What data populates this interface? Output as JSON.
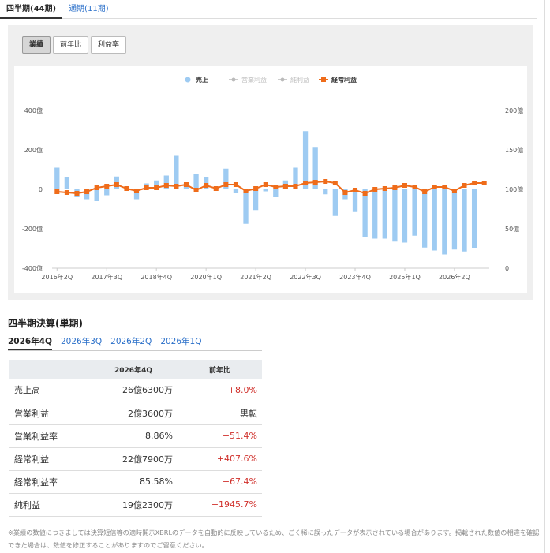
{
  "top_tabs": [
    {
      "label": "四半期(44期)",
      "active": true
    },
    {
      "label": "通期(11期)",
      "active": false
    }
  ],
  "chart_buttons": [
    {
      "label": "業績",
      "active": true
    },
    {
      "label": "前年比",
      "active": false
    },
    {
      "label": "利益率",
      "active": false
    }
  ],
  "colors": {
    "sales_bar": "#9ecbf2",
    "ordinary_profit": "#ef6c1a",
    "operating_profit": "#bbbbbb",
    "net_profit": "#bbbbbb",
    "link": "#2a6fc9",
    "positive": "#d0302b"
  },
  "chart_data": {
    "type": "bar",
    "legend": [
      {
        "name": "売上",
        "marker": "dot",
        "enabled": true
      },
      {
        "name": "営業利益",
        "marker": "line-dot",
        "enabled": false
      },
      {
        "name": "純利益",
        "marker": "line-dot",
        "enabled": false
      },
      {
        "name": "経常利益",
        "marker": "line-square",
        "enabled": true
      }
    ],
    "legend_position": "top-center",
    "left_axis": {
      "ticks": [
        "400億",
        "200億",
        "0",
        "-200億",
        "-400億"
      ],
      "ylim": [
        -400,
        400
      ]
    },
    "right_axis": {
      "ticks": [
        "200億",
        "150億",
        "100億",
        "50億",
        "0"
      ],
      "ylim": [
        0,
        200
      ]
    },
    "x_tick_labels": [
      "2016年2Q",
      "2017年3Q",
      "2018年4Q",
      "2020年1Q",
      "2021年2Q",
      "2022年3Q",
      "2023年4Q",
      "2025年1Q",
      "2026年2Q"
    ],
    "x_tick_every": 5,
    "grid": false,
    "series": [
      {
        "name": "売上",
        "axis": "left",
        "values": [
          110,
          60,
          -40,
          -50,
          -60,
          -30,
          65,
          10,
          -50,
          30,
          45,
          70,
          170,
          30,
          80,
          60,
          10,
          105,
          -20,
          -175,
          -105,
          -10,
          -40,
          45,
          110,
          295,
          215,
          -25,
          -135,
          -50,
          -115,
          -240,
          -250,
          -250,
          -265,
          -270,
          -235,
          -295,
          -310,
          -330,
          -305,
          -315,
          -300
        ]
      },
      {
        "name": "経常利益",
        "axis": "right",
        "values": [
          97,
          96,
          95,
          97,
          102,
          104,
          106,
          101,
          98,
          102,
          102,
          105,
          104,
          106,
          99,
          105,
          101,
          106,
          106,
          98,
          101,
          106,
          103,
          104,
          104,
          108,
          109,
          110,
          108,
          96,
          99,
          95,
          100,
          101,
          102,
          105,
          103,
          97,
          103,
          103,
          98,
          105,
          108,
          108
        ]
      }
    ]
  },
  "quarterly": {
    "heading": "四半期決算(単期)",
    "tabs": [
      {
        "label": "2026年4Q",
        "active": true
      },
      {
        "label": "2026年3Q",
        "active": false
      },
      {
        "label": "2026年2Q",
        "active": false
      },
      {
        "label": "2026年1Q",
        "active": false
      }
    ],
    "columns": [
      "",
      "2026年4Q",
      "前年比"
    ],
    "rows": [
      {
        "label": "売上高",
        "value": "26億6300万",
        "yoy": "+8.0%",
        "positive": true
      },
      {
        "label": "営業利益",
        "value": "2億3600万",
        "yoy": "黒転",
        "positive": false
      },
      {
        "label": "営業利益率",
        "value": "8.86%",
        "yoy": "+51.4%",
        "positive": true
      },
      {
        "label": "経常利益",
        "value": "22億7900万",
        "yoy": "+407.6%",
        "positive": true
      },
      {
        "label": "経常利益率",
        "value": "85.58%",
        "yoy": "+67.4%",
        "positive": true
      },
      {
        "label": "純利益",
        "value": "19億2300万",
        "yoy": "+1945.7%",
        "positive": true
      }
    ]
  },
  "footnote": "※業績の数値につきましては決算短信等の適時開示XBRLのデータを自動的に反映しているため、ごく稀に誤ったデータが表示されている場合があります。掲載された数値の相違を確認できた場合は、数値を修正することがありますのでご留意ください。"
}
